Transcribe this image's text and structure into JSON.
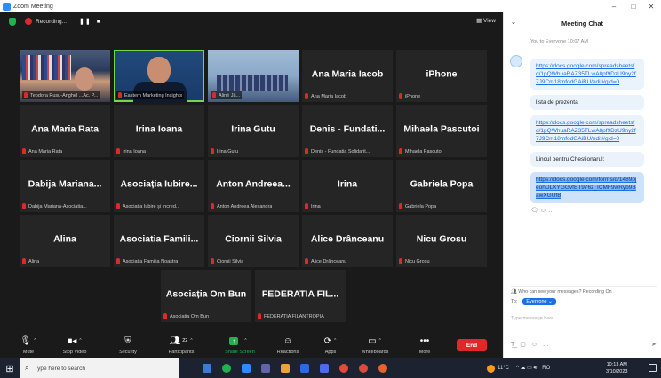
{
  "window": {
    "title": "Zoom Meeting",
    "controls": [
      "–",
      "□",
      "✕"
    ]
  },
  "recording": {
    "label": "Recording...",
    "pause": "❚❚",
    "stop": "■"
  },
  "view_label": "View",
  "tiles": [
    {
      "type": "video",
      "label": "Teodora Rusu-Anghel ...Ac. P...",
      "variant": "v1"
    },
    {
      "type": "video",
      "label": "Eastern Marketing Insights",
      "variant": "v2",
      "active": true
    },
    {
      "type": "video",
      "label": "Aliné Jă...",
      "variant": "v3"
    },
    {
      "type": "name",
      "name": "Ana Maria Iacob",
      "label": "Ana Maria Iacob"
    },
    {
      "type": "name",
      "name": "iPhone",
      "label": "iPhone"
    },
    {
      "type": "name",
      "name": "Ana Maria Rata",
      "label": "Ana Maria Rata"
    },
    {
      "type": "name",
      "name": "Irina Ioana",
      "label": "Irina Ioana"
    },
    {
      "type": "name",
      "name": "Irina Gutu",
      "label": "Irina Gutu"
    },
    {
      "type": "name",
      "name": "Denis - Fundati...",
      "label": "Denis - Fundatia Solidarit..."
    },
    {
      "type": "name",
      "name": "Mihaela Pascutoi",
      "label": "Mihaela Pascutoi"
    },
    {
      "type": "name",
      "name": "Dabija Mariana...",
      "label": "Dabija Mariana-Asociatia..."
    },
    {
      "type": "name",
      "name": "Asociația Iubire...",
      "label": "Asociatia Iubire și Încred..."
    },
    {
      "type": "name",
      "name": "Anton Andreea...",
      "label": "Anton Andreea Alexandra"
    },
    {
      "type": "name",
      "name": "Irina",
      "label": "Irina"
    },
    {
      "type": "name",
      "name": "Gabriela Popa",
      "label": "Gabriela Popa"
    },
    {
      "type": "name",
      "name": "Alina",
      "label": "Alina"
    },
    {
      "type": "name",
      "name": "Asociatia Famili...",
      "label": "Asociatia Familia Noastra"
    },
    {
      "type": "name",
      "name": "Ciornii Silvia",
      "label": "Ciornii Silvia"
    },
    {
      "type": "name",
      "name": "Alice Drânceanu",
      "label": "Alice Drânceanu"
    },
    {
      "type": "name",
      "name": "Nicu Grosu",
      "label": "Nicu Grosu"
    },
    {
      "type": "name",
      "name": "Asociația Om Bun",
      "label": "Asociatia Om Bun"
    },
    {
      "type": "name",
      "name": "FEDERATIA FIL...",
      "label": "FEDERATIA FILANTROPIA"
    }
  ],
  "toolbar": {
    "mute": "Mute",
    "stop_video": "Stop Video",
    "security": "Security",
    "participants": "Participants",
    "participant_count": "22",
    "share_screen": "Share Screen",
    "reactions": "Reactions",
    "apps": "Apps",
    "whiteboards": "Whiteboards",
    "more": "More",
    "end": "End"
  },
  "chat": {
    "title": "Meeting Chat",
    "meta": "You to Everyone 10:07 AM",
    "messages": [
      {
        "text": "https://docs.google.com/spreadsheets/d/1pQWhuaRAZ35TLwA8pf9DzU9ny2f7J9Cm18mfodGAiBU/edit#gid=0",
        "kind": "link"
      },
      {
        "text": "lista de prezenta",
        "kind": "text"
      },
      {
        "text": "https://docs.google.com/spreadsheets/d/1pQWhuaRAZ35TLwA8pf9DzU9ny2f7J9Cm18mfodGAiBU/edit#gid=0",
        "kind": "link"
      },
      {
        "text": "Lincul pentru Chestionarul:",
        "kind": "text"
      },
      {
        "text": "https://docs.google.com/forms/d/1489pjeohDLXYGGvfET976z_ICMF9wRyb9BawXGUfB",
        "kind": "selected"
      }
    ],
    "who_can_see": "Who can see your messages? Recording On",
    "to_label": "To:",
    "to_value": "Everyone",
    "input_placeholder": "Type message here..."
  },
  "taskbar": {
    "search_placeholder": "Type here to search",
    "weather": "11°C",
    "time": "10:13 AM",
    "date": "3/10/2023",
    "lang": "RO"
  },
  "taskbar_app_colors": [
    "#3a7bd5",
    "#20b14c",
    "#2d8cff",
    "#6264a7",
    "#e8a33a",
    "#2b6cdb",
    "#4f6bed",
    "#e34a3a",
    "#d94a3a",
    "#e8622a"
  ]
}
